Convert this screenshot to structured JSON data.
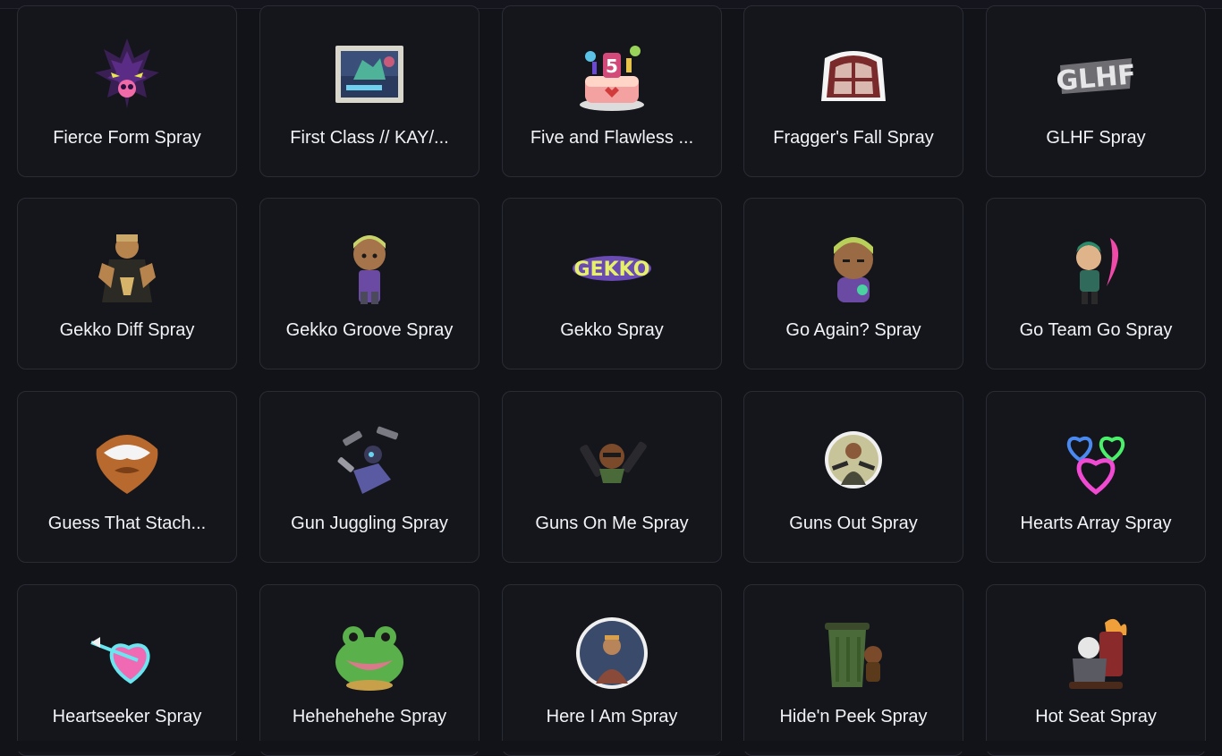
{
  "sprays": [
    {
      "name": "Fierce Form Spray",
      "icon": "fierce-form-icon"
    },
    {
      "name": "First Class // KAY/...",
      "icon": "first-class-stamp-icon"
    },
    {
      "name": "Five and Flawless ...",
      "icon": "birthday-cake-icon"
    },
    {
      "name": "Fragger's Fall Spray",
      "icon": "window-icon"
    },
    {
      "name": "GLHF Spray",
      "icon": "glhf-graffiti-icon"
    },
    {
      "name": "Gekko Diff Spray",
      "icon": "gekko-pose-icon"
    },
    {
      "name": "Gekko Groove Spray",
      "icon": "gekko-chibi-icon"
    },
    {
      "name": "Gekko Spray",
      "icon": "gekko-graffiti-icon"
    },
    {
      "name": "Go Again? Spray",
      "icon": "gekko-face-icon"
    },
    {
      "name": "Go Team Go Spray",
      "icon": "cheer-blade-icon"
    },
    {
      "name": "Guess That Stach...",
      "icon": "mustache-beard-icon"
    },
    {
      "name": "Gun Juggling Spray",
      "icon": "gun-juggling-icon"
    },
    {
      "name": "Guns On Me Spray",
      "icon": "dual-guns-icon"
    },
    {
      "name": "Guns Out Spray",
      "icon": "guns-out-badge-icon"
    },
    {
      "name": "Hearts Array Spray",
      "icon": "neon-hearts-icon"
    },
    {
      "name": "Heartseeker Spray",
      "icon": "neon-heart-arrow-icon"
    },
    {
      "name": "Hehehehehe Spray",
      "icon": "frog-icon"
    },
    {
      "name": "Here I Am Spray",
      "icon": "circle-portrait-icon"
    },
    {
      "name": "Hide'n Peek Spray",
      "icon": "trash-can-icon"
    },
    {
      "name": "Hot Seat Spray",
      "icon": "hot-seat-icon"
    }
  ]
}
